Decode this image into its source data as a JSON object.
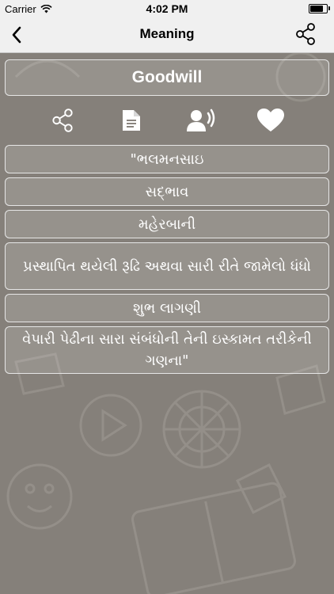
{
  "status_bar": {
    "carrier": "Carrier",
    "time": "4:02 PM",
    "battery_level": 0.85
  },
  "nav": {
    "title": "Meaning",
    "back_icon": "chevron-left-icon",
    "share_icon": "share-icon"
  },
  "word": "Goodwill",
  "actions": [
    {
      "name": "share-action",
      "icon": "share-icon"
    },
    {
      "name": "document-action",
      "icon": "document-icon"
    },
    {
      "name": "speak-action",
      "icon": "speaker-voice-icon"
    },
    {
      "name": "favorite-action",
      "icon": "heart-icon"
    }
  ],
  "meanings": [
    "\"ભલમનસાઇ",
    "સદ્ભાવ",
    "મહેરબાની",
    "પ્રસ્થાપિત થયેલી રૂઢિ અથવા સારી રીતે જામેલો ધંધો",
    "શુભ લાગણી",
    "વેપારી પેઢીના સારા સંબંધોની તેની ઇસ્કામત તરીકેની ગણના\""
  ],
  "colors": {
    "background": "#85807a",
    "bar": "#f0f0f0",
    "text": "#ffffff",
    "border": "#e6e6e6"
  }
}
